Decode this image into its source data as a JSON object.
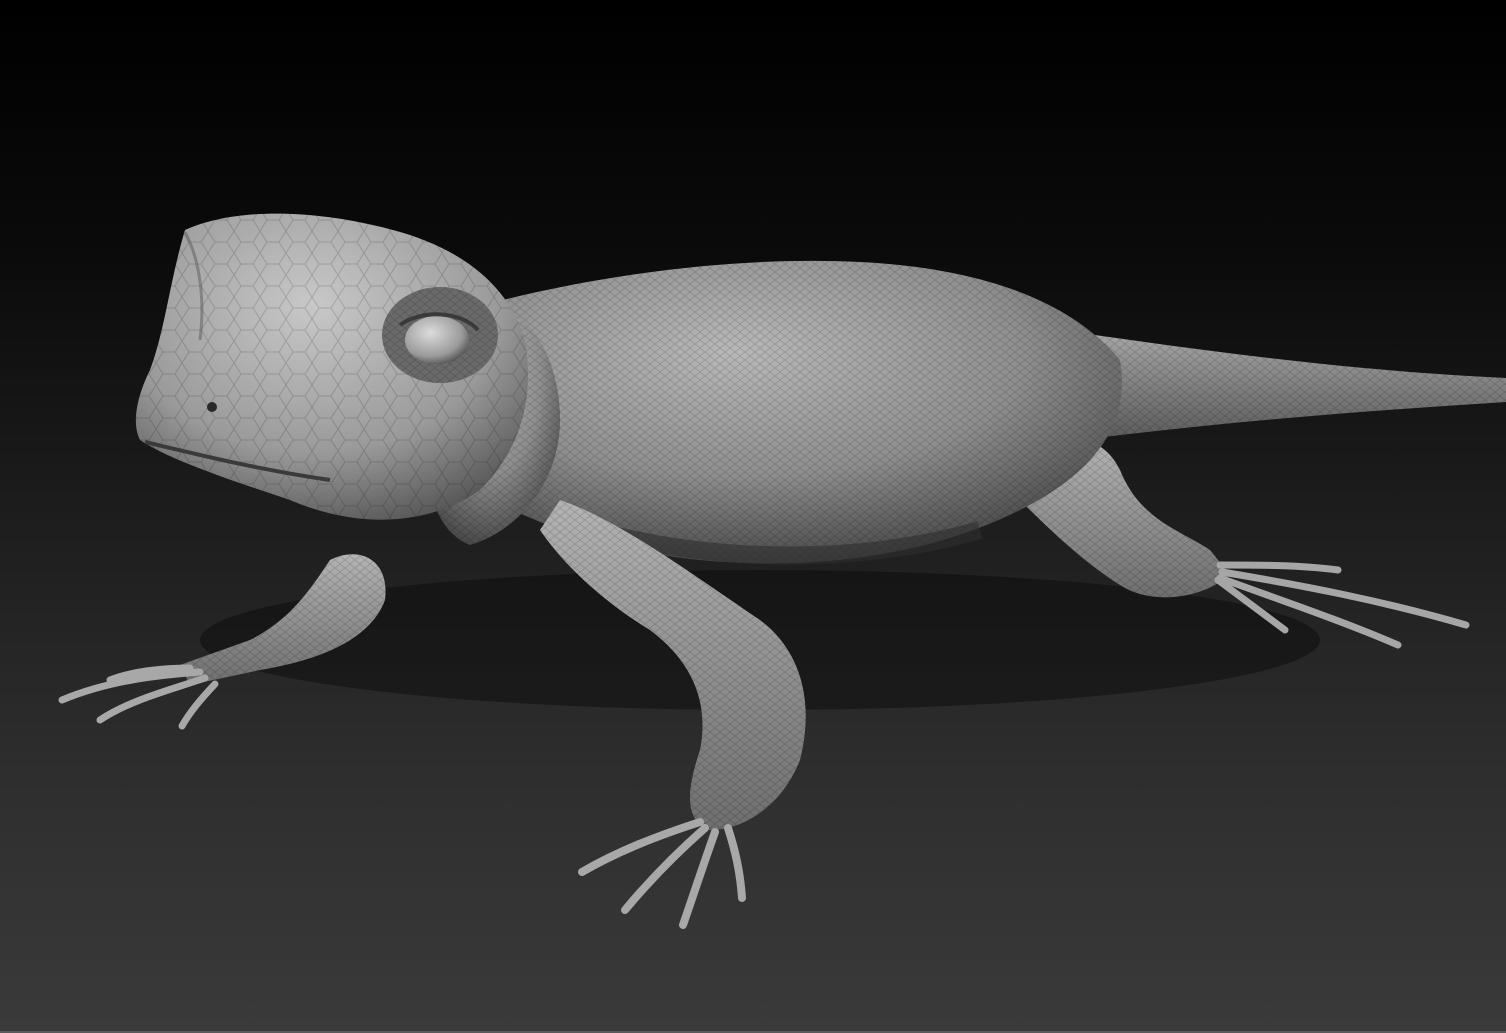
{
  "scene": {
    "subject": "lizard-sculpt",
    "render_style": "matcap-grey",
    "colors": {
      "background_top": "#000000",
      "background_bottom": "#3a3a3a",
      "skin_light": "#bdbdbd",
      "skin_mid": "#8a8a8a",
      "skin_dark": "#4a4a4a"
    }
  }
}
